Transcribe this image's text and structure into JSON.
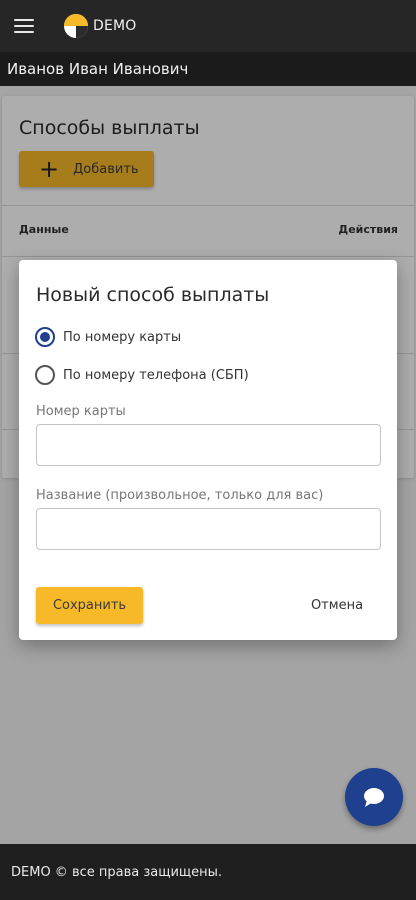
{
  "app": {
    "logo_text": "DEMO",
    "user_name": "Иванов Иван Иванович",
    "footer_text": "DEMO © все права защищены."
  },
  "page": {
    "title": "Способы выплаты",
    "add_button": "Добавить",
    "table": {
      "columns": [
        "Данные",
        "Действия"
      ]
    }
  },
  "dialog": {
    "title": "Новый способ выплаты",
    "options": [
      {
        "label": "По номеру карты",
        "checked": true
      },
      {
        "label": "По номеру телефона (СБП)",
        "checked": false
      }
    ],
    "card_number": {
      "label": "Номер карты",
      "value": ""
    },
    "name": {
      "label": "Название (произвольное, только для вас)",
      "value": ""
    },
    "save_button": "Сохранить",
    "cancel_button": "Отмена"
  },
  "colors": {
    "accent": "#f7b928",
    "primary": "#1f3f8f",
    "appbar": "#262626"
  },
  "icons": {
    "menu": "menu-icon",
    "plus": "plus-icon",
    "chat": "chat-icon",
    "logo": "demo-logo-icon"
  }
}
